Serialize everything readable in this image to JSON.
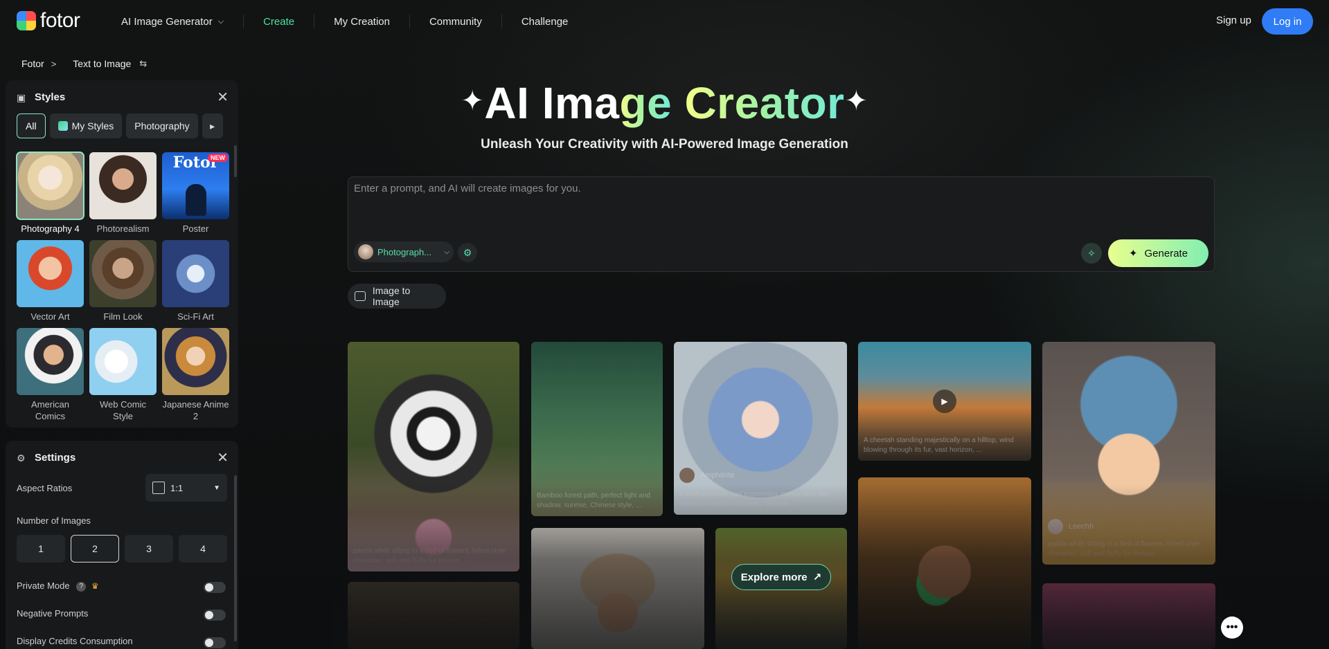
{
  "brand": {
    "name": "fotor"
  },
  "nav": {
    "items": [
      {
        "label": "AI Image Generator",
        "dropdown": true,
        "active": false
      },
      {
        "label": "Create",
        "dropdown": false,
        "active": true
      },
      {
        "label": "My Creation",
        "dropdown": false,
        "active": false
      },
      {
        "label": "Community",
        "dropdown": false,
        "active": false
      },
      {
        "label": "Challenge",
        "dropdown": false,
        "active": false
      }
    ],
    "signup": "Sign up",
    "login": "Log in"
  },
  "breadcrumb": {
    "root": "Fotor",
    "current": "Text to Image"
  },
  "styles_panel": {
    "title": "Styles",
    "chips": [
      "All",
      "My Styles",
      "Photography"
    ],
    "items": [
      {
        "label": "Photography 4",
        "selected": true,
        "badge": ""
      },
      {
        "label": "Photorealism",
        "selected": false,
        "badge": ""
      },
      {
        "label": "Poster",
        "selected": false,
        "badge": "NEW",
        "thumb_text": "Fotor"
      },
      {
        "label": "Vector Art",
        "selected": false,
        "badge": ""
      },
      {
        "label": "Film Look",
        "selected": false,
        "badge": ""
      },
      {
        "label": "Sci-Fi Art",
        "selected": false,
        "badge": ""
      },
      {
        "label": "American Comics",
        "selected": false,
        "badge": ""
      },
      {
        "label": "Web Comic Style",
        "selected": false,
        "badge": ""
      },
      {
        "label": "Japanese Anime 2",
        "selected": false,
        "badge": ""
      }
    ]
  },
  "settings_panel": {
    "title": "Settings",
    "aspect_label": "Aspect Ratios",
    "aspect_value": "1:1",
    "num_images_label": "Number of Images",
    "num_options": [
      "1",
      "2",
      "3",
      "4"
    ],
    "num_selected": "2",
    "private_mode": "Private Mode",
    "negative_prompts": "Negative Prompts",
    "display_credits": "Display Credits Consumption"
  },
  "hero": {
    "title_white": "AI Ima",
    "title_grad1": "ge",
    "title_grad2": "Creator",
    "subtitle": "Unleash Your Creativity with AI-Powered Image Generation"
  },
  "prompt": {
    "placeholder": "Enter a prompt, and AI will create images for you.",
    "style_pill": "Photograph...",
    "generate": "Generate"
  },
  "image_to_image": "Image to Image",
  "gallery": {
    "cards": [
      {
        "caption": "panda while sitting in a bed of flowers, felted-style character, soft and fluffy fur texture, ...",
        "user": ""
      },
      {
        "caption": "Bamboo forest path, perfect light and shadow, sunrise, Chinese style, ...",
        "user": ""
      },
      {
        "caption": "A Wolf princess, sad expression, messy blue hair, wearing minority costumes, delicate ...",
        "user": "Amphitrite"
      },
      {
        "caption": "A cheetah standing majestically on a hilltop, wind blowing through its fur, vast horizon, ...",
        "user": ""
      },
      {
        "caption": "panda while sitting in a bed of flowers, felted-style character, soft and fluffy fur texture, ...",
        "user": "Leechh"
      }
    ],
    "explore": "Explore more"
  },
  "colors": {
    "accent": "#4ee0a0",
    "login_bg": "#2f7cf6",
    "panel_bg": "#17191b"
  }
}
